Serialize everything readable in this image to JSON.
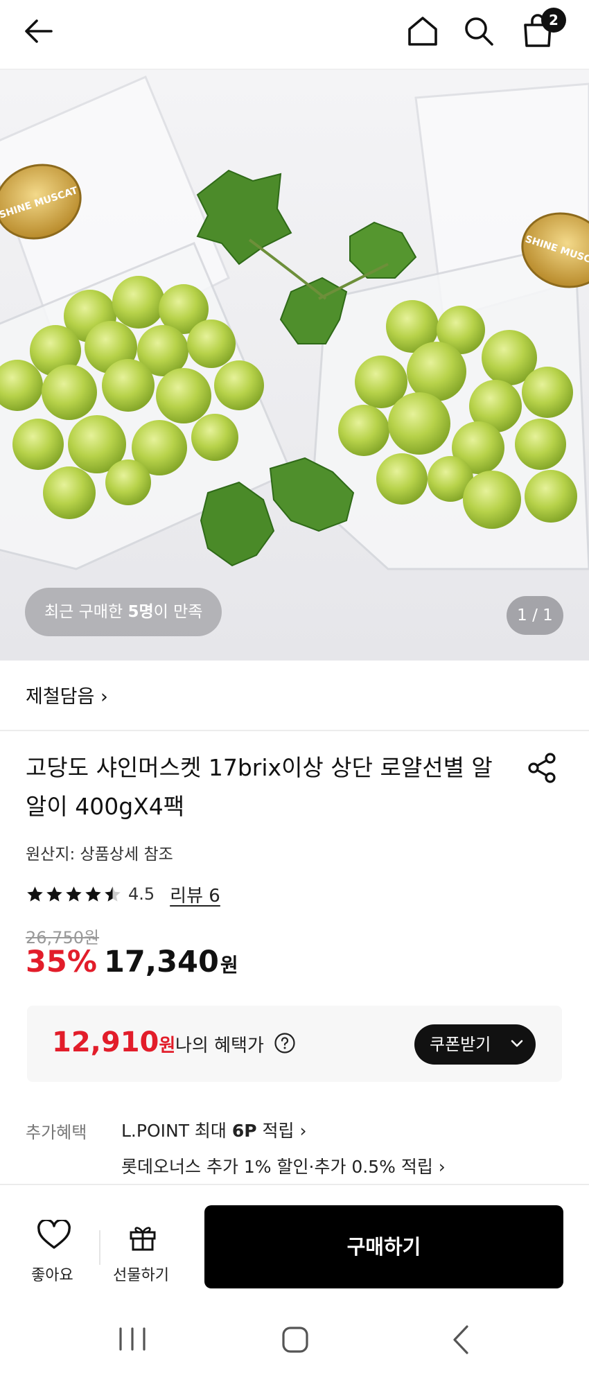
{
  "header": {
    "back": "back-arrow-icon",
    "home": "home-icon",
    "search": "search-icon",
    "cart": "shopping-bag-icon",
    "cart_count": "2"
  },
  "hero": {
    "recent_prefix": "최근 구매한 ",
    "recent_count": "5명",
    "recent_suffix": "이 만족",
    "counter": "1 / 1",
    "label_text": "SHINE MUSCAT"
  },
  "brand": {
    "name": "제철담음 ›"
  },
  "product": {
    "title": "고당도 샤인머스켓 17brix이상 상단 로얄선별 알알이 400gX4팩",
    "origin": "원산지: 상품상세 참조",
    "rating": "4.5",
    "rating_value": 4.5,
    "review": "리뷰 6",
    "original_price": "26,750원",
    "discount": "35%",
    "price": "17,340",
    "currency": "원"
  },
  "benefit": {
    "price": "12,910",
    "currency": "원",
    "label": "나의 혜택가",
    "coupon_button": "쿠폰받기"
  },
  "extra": {
    "label": "추가혜택",
    "line1_prefix": "L.POINT 최대 ",
    "line1_bold": "6P",
    "line1_suffix": " 적립 ›",
    "line2": "롯데오너스 추가 1% 할인·추가 0.5% 적립 ›"
  },
  "actions": {
    "like": "좋아요",
    "gift": "선물하기",
    "buy": "구매하기"
  },
  "colors": {
    "accent": "#e21d2a",
    "primary_button": "#000000"
  }
}
